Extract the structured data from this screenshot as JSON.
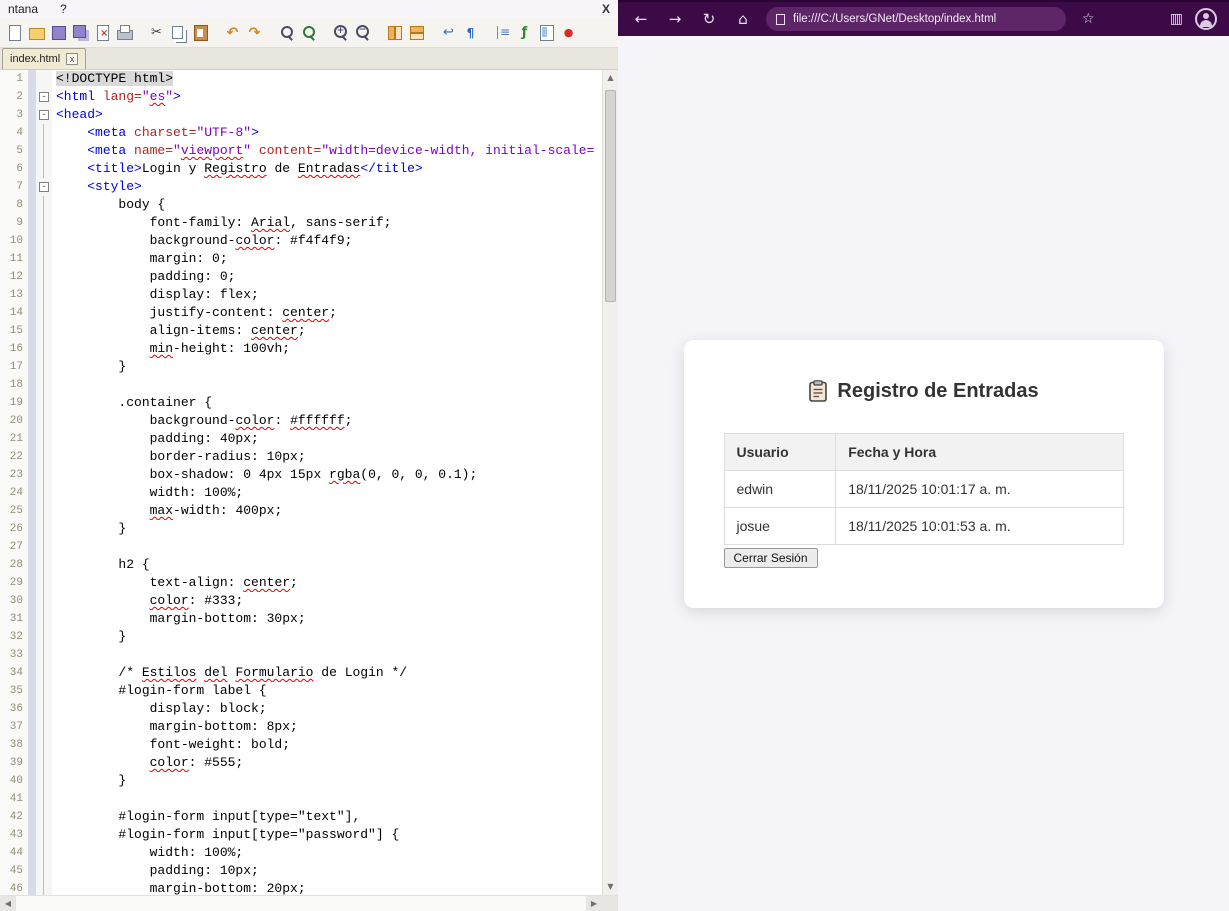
{
  "window": {
    "menubar": {
      "items": [
        "ntana",
        "?"
      ],
      "close_label": "X"
    },
    "tab": {
      "label": "index.html",
      "close_glyph": "x"
    },
    "toolbar": {
      "icons": [
        "new-file",
        "open",
        "save",
        "save-all",
        "close",
        "print",
        "cut",
        "copy",
        "paste",
        "undo",
        "redo",
        "find",
        "replace",
        "zoom-in",
        "zoom-out",
        "sync-vertical",
        "sync-horizontal",
        "word-wrap",
        "show-all-characters",
        "indent-guide",
        "function-list",
        "document-map",
        "start-recording"
      ],
      "group_starts": [
        6,
        9,
        11,
        13,
        15,
        17,
        19
      ]
    }
  },
  "editor": {
    "fold_glyph": "-",
    "lines": [
      [
        0,
        [
          [
            "d",
            "<!DOCTYPE html>"
          ]
        ]
      ],
      [
        1,
        [
          [
            "t",
            "<html "
          ],
          [
            "a",
            "lang="
          ],
          [
            "s",
            "\""
          ],
          [
            "sw",
            "es"
          ],
          [
            "s",
            "\""
          ],
          [
            "t",
            ">"
          ]
        ]
      ],
      [
        1,
        [
          [
            "t",
            "<head>"
          ]
        ]
      ],
      [
        2,
        [
          [
            "p",
            "    "
          ],
          [
            "t",
            "<meta "
          ],
          [
            "a",
            "charset="
          ],
          [
            "s",
            "\"UTF-8\""
          ],
          [
            "t",
            ">"
          ]
        ]
      ],
      [
        2,
        [
          [
            "p",
            "    "
          ],
          [
            "t",
            "<meta "
          ],
          [
            "a",
            "name="
          ],
          [
            "s",
            "\""
          ],
          [
            "sw",
            "viewport"
          ],
          [
            "s",
            "\""
          ],
          [
            "p",
            " "
          ],
          [
            "a",
            "content="
          ],
          [
            "s",
            "\"width=device-width, initial-scale="
          ]
        ]
      ],
      [
        2,
        [
          [
            "p",
            "    "
          ],
          [
            "t",
            "<title>"
          ],
          [
            "p",
            "Login y "
          ],
          [
            "pw",
            "Registro"
          ],
          [
            "p",
            " de "
          ],
          [
            "pw",
            "Entradas"
          ],
          [
            "t",
            "</title>"
          ]
        ]
      ],
      [
        1,
        [
          [
            "p",
            "    "
          ],
          [
            "t",
            "<style>"
          ]
        ]
      ],
      [
        2,
        [
          [
            "p",
            "        body {"
          ]
        ]
      ],
      [
        2,
        [
          [
            "p",
            "            font-family: "
          ],
          [
            "pw",
            "Arial"
          ],
          [
            "p",
            ", sans-serif;"
          ]
        ]
      ],
      [
        2,
        [
          [
            "p",
            "            background-"
          ],
          [
            "pw",
            "color"
          ],
          [
            "p",
            ": #f4f4f9;"
          ]
        ]
      ],
      [
        2,
        [
          [
            "p",
            "            margin: 0;"
          ]
        ]
      ],
      [
        2,
        [
          [
            "p",
            "            padding: 0;"
          ]
        ]
      ],
      [
        2,
        [
          [
            "p",
            "            display: flex;"
          ]
        ]
      ],
      [
        2,
        [
          [
            "p",
            "            justify-content: "
          ],
          [
            "pw",
            "center"
          ],
          [
            "p",
            ";"
          ]
        ]
      ],
      [
        2,
        [
          [
            "p",
            "            align-items: "
          ],
          [
            "pw",
            "center"
          ],
          [
            "p",
            ";"
          ]
        ]
      ],
      [
        2,
        [
          [
            "p",
            "            "
          ],
          [
            "pw",
            "min"
          ],
          [
            "p",
            "-height: 100vh;"
          ]
        ]
      ],
      [
        2,
        [
          [
            "p",
            "        }"
          ]
        ]
      ],
      [
        2,
        []
      ],
      [
        2,
        [
          [
            "p",
            "        .container {"
          ]
        ]
      ],
      [
        2,
        [
          [
            "p",
            "            background-"
          ],
          [
            "pw",
            "color"
          ],
          [
            "p",
            ": "
          ],
          [
            "pw",
            "#ffffff"
          ],
          [
            "p",
            ";"
          ]
        ]
      ],
      [
        2,
        [
          [
            "p",
            "            padding: 40px;"
          ]
        ]
      ],
      [
        2,
        [
          [
            "p",
            "            border-radius: 10px;"
          ]
        ]
      ],
      [
        2,
        [
          [
            "p",
            "            box-shadow: 0 4px 15px "
          ],
          [
            "pw",
            "rgba"
          ],
          [
            "p",
            "(0, 0, 0, 0.1);"
          ]
        ]
      ],
      [
        2,
        [
          [
            "p",
            "            width: 100%;"
          ]
        ]
      ],
      [
        2,
        [
          [
            "p",
            "            "
          ],
          [
            "pw",
            "max"
          ],
          [
            "p",
            "-width: 400px;"
          ]
        ]
      ],
      [
        2,
        [
          [
            "p",
            "        }"
          ]
        ]
      ],
      [
        2,
        []
      ],
      [
        2,
        [
          [
            "p",
            "        h2 {"
          ]
        ]
      ],
      [
        2,
        [
          [
            "p",
            "            text-align: "
          ],
          [
            "pw",
            "center"
          ],
          [
            "p",
            ";"
          ]
        ]
      ],
      [
        2,
        [
          [
            "p",
            "            "
          ],
          [
            "pw",
            "color"
          ],
          [
            "p",
            ": #333;"
          ]
        ]
      ],
      [
        2,
        [
          [
            "p",
            "            margin-bottom: 30px;"
          ]
        ]
      ],
      [
        2,
        [
          [
            "p",
            "        }"
          ]
        ]
      ],
      [
        2,
        []
      ],
      [
        2,
        [
          [
            "p",
            "        /* "
          ],
          [
            "pw",
            "Estilos"
          ],
          [
            "p",
            " "
          ],
          [
            "pw",
            "del"
          ],
          [
            "p",
            " "
          ],
          [
            "pw",
            "Formulario"
          ],
          [
            "p",
            " de Login */"
          ]
        ]
      ],
      [
        2,
        [
          [
            "p",
            "        #login-form label {"
          ]
        ]
      ],
      [
        2,
        [
          [
            "p",
            "            display: block;"
          ]
        ]
      ],
      [
        2,
        [
          [
            "p",
            "            margin-bottom: 8px;"
          ]
        ]
      ],
      [
        2,
        [
          [
            "p",
            "            font-weight: bold;"
          ]
        ]
      ],
      [
        2,
        [
          [
            "p",
            "            "
          ],
          [
            "pw",
            "color"
          ],
          [
            "p",
            ": #555;"
          ]
        ]
      ],
      [
        2,
        [
          [
            "p",
            "        }"
          ]
        ]
      ],
      [
        2,
        []
      ],
      [
        2,
        [
          [
            "p",
            "        #login-form input[type=\"text\"],"
          ]
        ]
      ],
      [
        2,
        [
          [
            "p",
            "        #login-form input[type=\"password\"] {"
          ]
        ]
      ],
      [
        2,
        [
          [
            "p",
            "            width: 100%;"
          ]
        ]
      ],
      [
        2,
        [
          [
            "p",
            "            padding: 10px;"
          ]
        ]
      ],
      [
        2,
        [
          [
            "p",
            "            margin-bottom: 20px;"
          ]
        ]
      ]
    ]
  },
  "browser": {
    "address": "file:///C:/Users/GNet/Desktop/index.html",
    "icons": {
      "back": "←",
      "forward": "→",
      "refresh": "↻",
      "home": "⌂",
      "favorites": "☆",
      "panels": "▥"
    },
    "colors": {
      "chrome_bg": "#3c0b47",
      "address_bg": "#5e2569",
      "page_bg": "#f4f4f9"
    },
    "page": {
      "title": "Registro de Entradas",
      "table": {
        "headers": [
          "Usuario",
          "Fecha y Hora"
        ],
        "rows": [
          [
            "edwin",
            "18/11/2025 10:01:17 a. m."
          ],
          [
            "josue",
            "18/11/2025 10:01:53 a. m."
          ]
        ]
      },
      "logout_label": "Cerrar Sesión"
    }
  }
}
